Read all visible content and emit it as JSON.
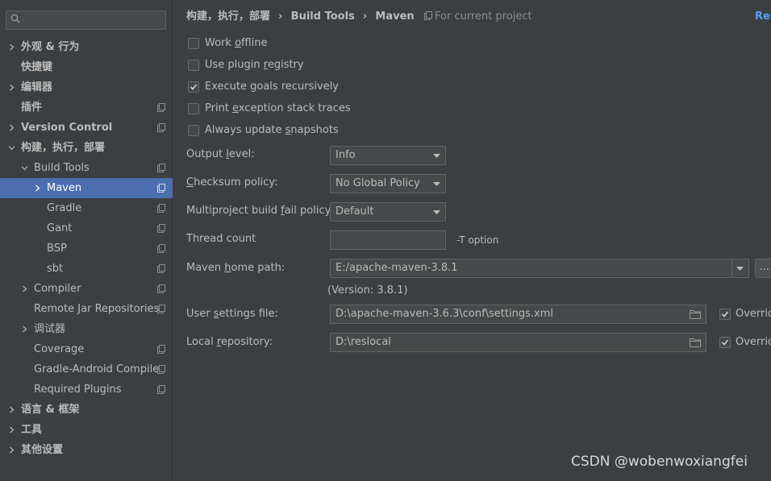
{
  "sidebar": {
    "search": {
      "value": "",
      "placeholder": ""
    },
    "items": [
      {
        "label": "外观 & 行为"
      },
      {
        "label": "快捷键"
      },
      {
        "label": "编辑器"
      },
      {
        "label": "插件"
      },
      {
        "label": "Version Control"
      },
      {
        "label": "构建，执行，部署"
      },
      {
        "label": "Build Tools"
      },
      {
        "label": "Maven"
      },
      {
        "label": "Gradle"
      },
      {
        "label": "Gant"
      },
      {
        "label": "BSP"
      },
      {
        "label": "sbt"
      },
      {
        "label": "Compiler"
      },
      {
        "label": "Remote Jar Repositories"
      },
      {
        "label": "调试器"
      },
      {
        "label": "Coverage"
      },
      {
        "label": "Gradle-Android Compiler"
      },
      {
        "label": "Required Plugins"
      },
      {
        "label": "语言 & 框架"
      },
      {
        "label": "工具"
      },
      {
        "label": "其他设置"
      }
    ]
  },
  "breadcrumb": {
    "parts": [
      "构建，执行，部署",
      "Build Tools",
      "Maven"
    ],
    "separator": "›"
  },
  "scope_label": "For current project",
  "reset_label": "Res",
  "options": {
    "work_offline": {
      "label": "Work offline",
      "checked": false
    },
    "use_plugin_registry": {
      "label": "Use plugin registry",
      "checked": false
    },
    "execute_goals_recursively": {
      "label": "Execute goals recursively",
      "checked": true
    },
    "print_exception_stack_traces": {
      "label": "Print exception stack traces",
      "checked": false
    },
    "always_update_snapshots": {
      "label": "Always update snapshots",
      "checked": false
    }
  },
  "output_level": {
    "label": "Output level:",
    "value": "Info"
  },
  "checksum_policy": {
    "label": "Checksum policy:",
    "value": "No Global Policy"
  },
  "fail_policy": {
    "label": "Multiproject build fail policy:",
    "value": "Default"
  },
  "thread_count": {
    "label": "Thread count",
    "value": "",
    "hint": "-T option"
  },
  "maven_home": {
    "label": "Maven home path:",
    "value": "E:/apache-maven-3.8.1",
    "version": "(Version: 3.8.1)",
    "browse": "..."
  },
  "user_settings": {
    "label": "User settings file:",
    "value": "D:\\apache-maven-3.6.3\\conf\\settings.xml",
    "override_label": "Overrid",
    "override_checked": true
  },
  "local_repo": {
    "label": "Local repository:",
    "value": "D:\\reslocal",
    "override_label": "Overrid",
    "override_checked": true
  },
  "watermark": "CSDN @wobenwoxiangfei",
  "colors": {
    "accent": "#4b6eaf",
    "link": "#589df6",
    "background": "#3c3f41"
  }
}
